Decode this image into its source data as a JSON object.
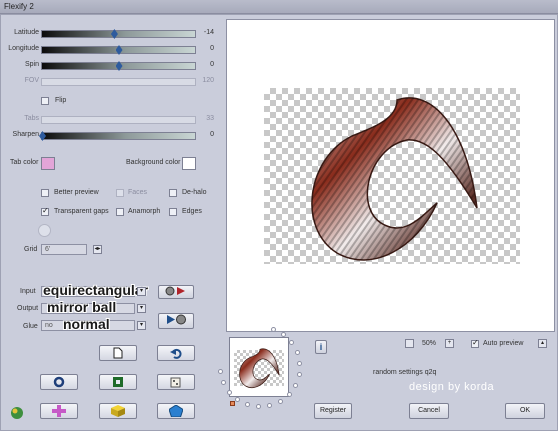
{
  "window": {
    "title": "Flexify 2"
  },
  "sliders": [
    {
      "label": "Latitude",
      "value": "-14",
      "level": 0.47,
      "enabled": true
    },
    {
      "label": "Longitude",
      "value": "0",
      "level": 0.5,
      "enabled": true
    },
    {
      "label": "Spin",
      "value": "0",
      "level": 0.5,
      "enabled": true
    },
    {
      "label": "FOV",
      "value": "120",
      "level": 0,
      "enabled": false
    }
  ],
  "flip": {
    "label": "Flip",
    "checked": false
  },
  "sliders2": [
    {
      "label": "Tabs",
      "value": "33",
      "level": 0,
      "enabled": false
    },
    {
      "label": "Sharpen",
      "value": "0",
      "level": 0.0,
      "enabled": true
    }
  ],
  "colors": {
    "tab_label": "Tab color",
    "tab_color": "#e3a5d8",
    "bg_label": "Background color",
    "bg_color": "#ffffff"
  },
  "checks": {
    "better_preview": {
      "label": "Better preview",
      "checked": false
    },
    "faces": {
      "label": "Faces",
      "checked": false,
      "enabled": false
    },
    "de_halo": {
      "label": "De-halo",
      "checked": false
    },
    "transparent_gaps": {
      "label": "Transparent gaps",
      "checked": true
    },
    "anamorph": {
      "label": "Anamorph",
      "checked": false
    },
    "edges": {
      "label": "Edges",
      "checked": false
    }
  },
  "grid": {
    "label": "Grid",
    "value": "6'",
    "btn": "◂▸"
  },
  "io": {
    "input_label": "Input",
    "input_value": "equirectangular",
    "output_label": "Output",
    "output_value": "mirror ball",
    "glue_label": "Glue",
    "glue_value": "normal",
    "glue_field": "no"
  },
  "zoom": {
    "value": "50%",
    "plus": "+"
  },
  "auto_preview": {
    "label": "Auto preview",
    "checked": true,
    "btn": "▴"
  },
  "info_label": "i",
  "random_text": "random settings q2q",
  "watermark": "design by korda",
  "buttons": {
    "register": "Register",
    "cancel": "Cancel",
    "ok": "OK"
  }
}
